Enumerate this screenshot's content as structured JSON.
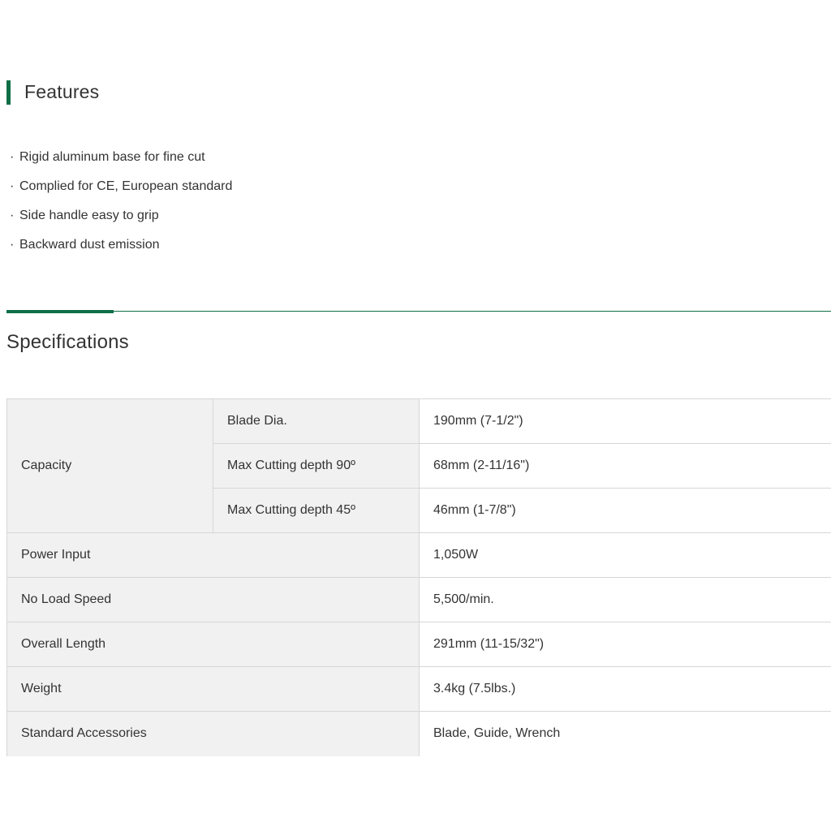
{
  "features": {
    "title": "Features",
    "accent_color": "#0f6e48",
    "bullet": "·",
    "items": [
      "Rigid aluminum base for fine cut",
      "Complied for CE, European standard",
      "Side handle easy to grip",
      "Backward dust emission"
    ]
  },
  "specifications": {
    "title": "Specifications",
    "capacity_label": "Capacity",
    "capacity_rows": [
      {
        "label": "Blade Dia.",
        "value": "190mm (7-1/2\")"
      },
      {
        "label": "Max Cutting depth 90º",
        "value": "68mm (2-11/16\")"
      },
      {
        "label": "Max Cutting depth 45º",
        "value": "46mm (1-7/8\")"
      }
    ],
    "rows": [
      {
        "label": "Power Input",
        "value": "1,050W"
      },
      {
        "label": "No Load Speed",
        "value": "5,500/min."
      },
      {
        "label": "Overall Length",
        "value": "291mm (11-15/32\")"
      },
      {
        "label": "Weight",
        "value": "3.4kg (7.5lbs.)"
      },
      {
        "label": "Standard Accessories",
        "value": "Blade, Guide, Wrench"
      }
    ]
  }
}
